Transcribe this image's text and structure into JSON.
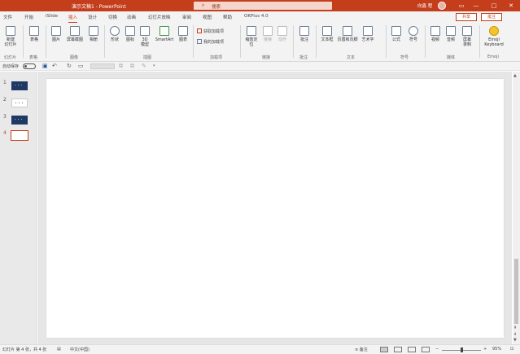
{
  "titlebar": {
    "doc_title": "演示文稿1 - PowerPoint",
    "search_placeholder": "搜索",
    "user_name": "向鑫 程",
    "minimize": "—",
    "maximize": "□",
    "close": "✕",
    "restore": "▭"
  },
  "tabs": [
    "文件",
    "开始",
    "iSlide",
    "插入",
    "设计",
    "切换",
    "动画",
    "幻灯片放映",
    "审阅",
    "视图",
    "帮助",
    "OKPlus 4.0"
  ],
  "active_tab": "插入",
  "share_label": "共享",
  "comment_label": "批注",
  "ribbon": {
    "new_slide": "新建\n幻灯片",
    "table": "表格",
    "picture": "图片",
    "screenshot": "屏幕截图",
    "album": "相册",
    "shapes": "形状",
    "icons": "图标",
    "model3d": "3D\n模型",
    "smartart": "SmartArt",
    "chart": "图表",
    "get_addins": "获取加载项",
    "my_addins": "我的加载项",
    "zoom": "缩放定\n位",
    "link": "链接",
    "action": "动作",
    "comment": "批注",
    "textbox": "文本框",
    "header_footer": "页眉和页脚",
    "wordart": "艺术字",
    "equation": "公式",
    "symbol": "符号",
    "video": "视频",
    "audio": "音频",
    "screen_record": "屏幕\n录制",
    "emoji": "Emoji\nKeyboard",
    "groups": {
      "slides": "幻灯片",
      "table": "表格",
      "images": "图像",
      "illustrations": "插图",
      "addins": "加载项",
      "links": "链接",
      "comments": "批注",
      "text": "文本",
      "symbols": "符号",
      "media": "媒体",
      "emoji": "Emoji"
    }
  },
  "qat": {
    "autosave": "自动保存",
    "toggle_state": "关"
  },
  "thumbnails": [
    {
      "num": "1",
      "style": "dark"
    },
    {
      "num": "2",
      "style": "light"
    },
    {
      "num": "3",
      "style": "dark"
    },
    {
      "num": "4",
      "style": "selected"
    }
  ],
  "status": {
    "slide_info": "幻灯片 第 4 张，共 4 张",
    "language": "中文(中国)",
    "notes": "备注",
    "zoom_level": "95%"
  },
  "colors": {
    "accent": "#c43e1c",
    "ribbon_bg": "#f3f3f3",
    "thumb_dark": "#1f3864"
  }
}
